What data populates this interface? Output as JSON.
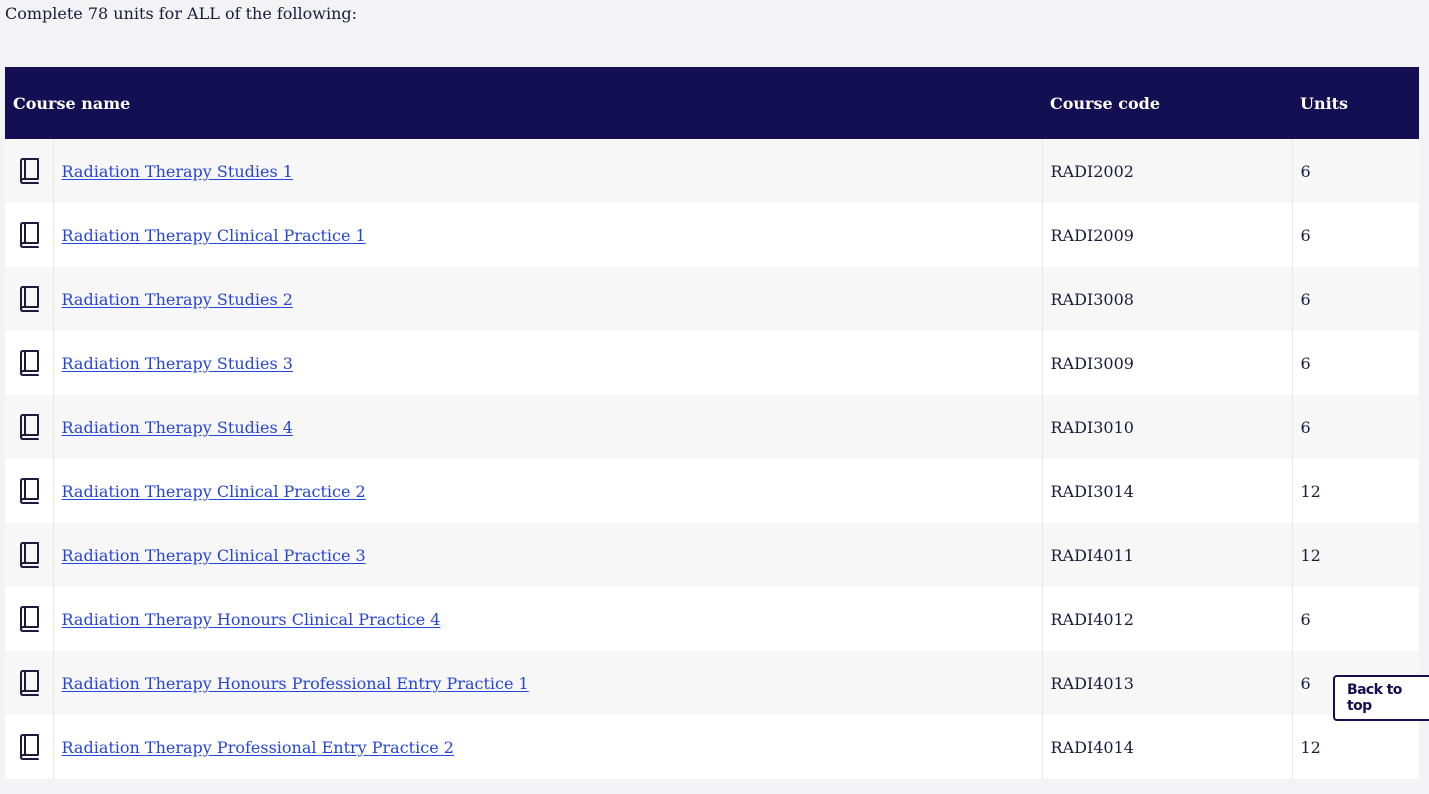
{
  "intro_text": "Complete 78 units for ALL of the following:",
  "table": {
    "headers": {
      "name": "Course name",
      "code": "Course code",
      "units": "Units"
    },
    "rows": [
      {
        "name": "Radiation Therapy Studies 1",
        "code": "RADI2002",
        "units": "6"
      },
      {
        "name": "Radiation Therapy Clinical Practice 1",
        "code": "RADI2009",
        "units": "6"
      },
      {
        "name": "Radiation Therapy Studies 2",
        "code": "RADI3008",
        "units": "6"
      },
      {
        "name": "Radiation Therapy Studies 3",
        "code": "RADI3009",
        "units": "6"
      },
      {
        "name": "Radiation Therapy Studies 4",
        "code": "RADI3010",
        "units": "6"
      },
      {
        "name": "Radiation Therapy Clinical Practice 2",
        "code": "RADI3014",
        "units": "12"
      },
      {
        "name": "Radiation Therapy Clinical Practice 3",
        "code": "RADI4011",
        "units": "12"
      },
      {
        "name": "Radiation Therapy Honours Clinical Practice 4",
        "code": "RADI4012",
        "units": "6"
      },
      {
        "name": "Radiation Therapy Honours Professional Entry Practice 1",
        "code": "RADI4013",
        "units": "6"
      },
      {
        "name": "Radiation Therapy Professional Entry Practice 2",
        "code": "RADI4014",
        "units": "12"
      }
    ]
  },
  "back_to_top": {
    "label": "Back to top",
    "icon": "chevron-up-icon"
  },
  "colors": {
    "header_bg": "#130f52",
    "link": "#2445d8",
    "text": "#1b1b3a"
  }
}
